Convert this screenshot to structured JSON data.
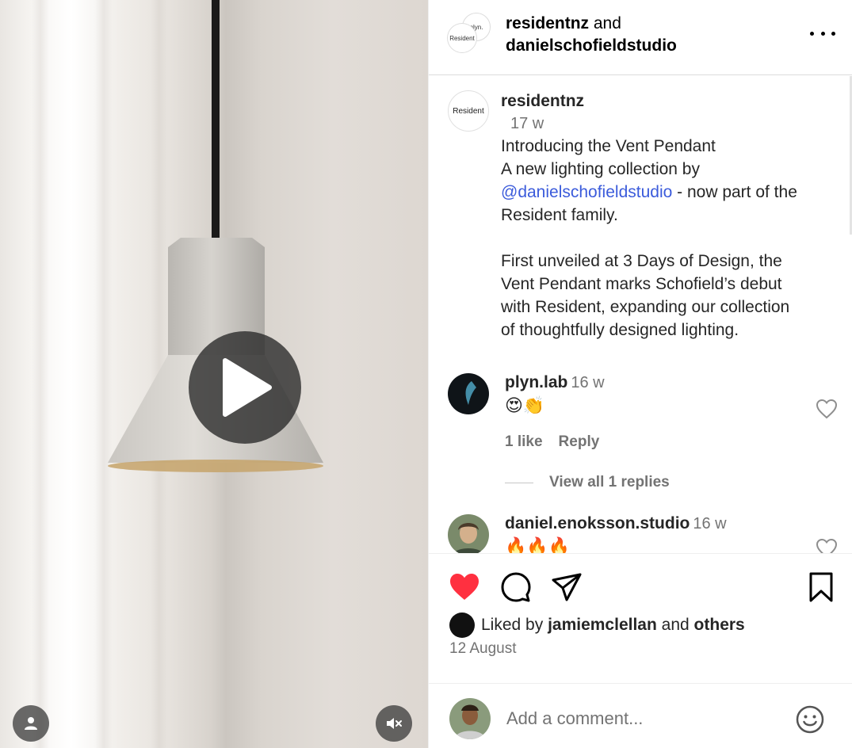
{
  "header": {
    "author_primary": "residentnz",
    "joiner": "and",
    "author_secondary": "danielschofieldstudio",
    "avatar_back_text": "plyn.",
    "avatar_front_text": "Resident"
  },
  "caption": {
    "avatar_text": "Resident",
    "username": "residentnz",
    "time": "17 w",
    "line1": "Introducing the Vent Pendant",
    "line2": "A new lighting collection by",
    "mention": "@danielschofieldstudio",
    "line3_rest": " - now part of the",
    "line4": "Resident family.",
    "para2": "First unveiled at 3 Days of Design, the\nVent Pendant marks Schofield’s debut\nwith Resident, expanding our collection\nof thoughtfully designed lighting."
  },
  "comments": [
    {
      "username": "plyn.lab",
      "time": "16 w",
      "text": "😍👏",
      "likes": "1 like",
      "reply": "Reply",
      "view_replies": "View all 1 replies"
    },
    {
      "username": "daniel.enoksson.studio",
      "time": "16 w",
      "text": "🔥🔥🔥"
    }
  ],
  "likes": {
    "prefix": "Liked by",
    "user": "jamiemclellan",
    "and": "and",
    "others": "others"
  },
  "date": "12 August",
  "comment_box": {
    "placeholder": "Add a comment..."
  },
  "colors": {
    "heart_red": "#ff3040",
    "mention_blue": "#3b5bdb",
    "muted_text": "#737373"
  },
  "icons": [
    "play-icon",
    "user-icon",
    "mute-icon",
    "more-icon",
    "heart-icon",
    "comment-icon",
    "share-icon",
    "bookmark-icon",
    "smile-icon"
  ]
}
